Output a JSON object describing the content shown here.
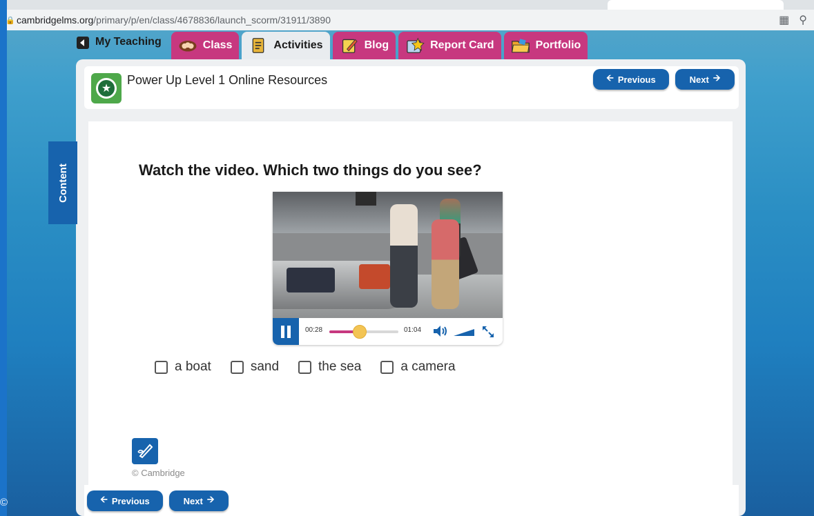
{
  "browser": {
    "url_domain": "cambridgelms.org",
    "url_path": "/primary/p/en/class/4678836/launch_scorm/31911/3890"
  },
  "nav": {
    "tabs": [
      {
        "label": "My Teaching",
        "icon": "back-arrow-icon"
      },
      {
        "label": "Class",
        "icon": "class-icon"
      },
      {
        "label": "Activities",
        "icon": "activities-icon"
      },
      {
        "label": "Blog",
        "icon": "blog-icon"
      },
      {
        "label": "Report Card",
        "icon": "report-card-icon"
      },
      {
        "label": "Portfolio",
        "icon": "portfolio-icon"
      }
    ]
  },
  "header": {
    "title": "Power Up Level 1 Online Resources",
    "previous_label": "Previous",
    "next_label": "Next"
  },
  "sidebar": {
    "content_label": "Content"
  },
  "activity": {
    "question": "Watch the video. Which two things do you see?",
    "video": {
      "current_time": "00:28",
      "duration": "01:04",
      "progress": 0.44,
      "state": "playing"
    },
    "options": [
      "a boat",
      "sand",
      "the sea",
      "a camera"
    ]
  },
  "footer": {
    "copyright": "© Cambridge",
    "previous_label": "Previous",
    "next_label": "Next"
  },
  "corner_text": "©",
  "colors": {
    "primary": "#1763ad",
    "tab_magenta": "#c7387f",
    "logo_green": "#4ea84a",
    "progress_knob": "#f3c454"
  }
}
